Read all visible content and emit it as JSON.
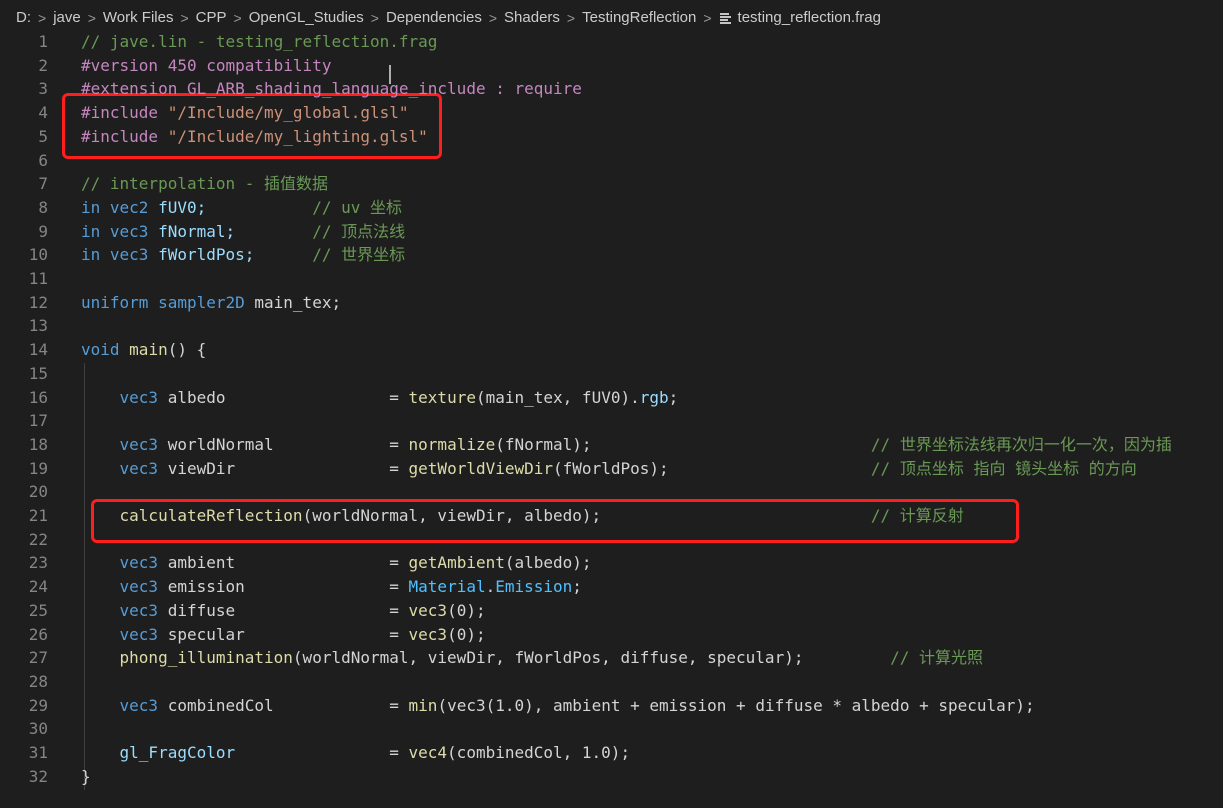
{
  "breadcrumb": {
    "items": [
      "D:",
      "jave",
      "Work Files",
      "CPP",
      "OpenGL_Studies",
      "Dependencies",
      "Shaders",
      "TestingReflection"
    ],
    "file": "testing_reflection.frag",
    "separator": ">"
  },
  "editor": {
    "lines": [
      {
        "n": "1",
        "tokens": [
          [
            "// jave.lin - testing_reflection",
            "comment"
          ],
          [
            ".frag",
            "comment"
          ]
        ]
      },
      {
        "n": "2",
        "tokens": [
          [
            "#version 450 compatibility",
            "pp"
          ]
        ]
      },
      {
        "n": "3",
        "tokens": [
          [
            "#extension GL_ARB_shading_language_include : require",
            "pp"
          ]
        ]
      },
      {
        "n": "4",
        "tokens": [
          [
            "#include ",
            "pp"
          ],
          [
            "\"/Include/my_global.glsl\"",
            "str"
          ]
        ]
      },
      {
        "n": "5",
        "tokens": [
          [
            "#include ",
            "pp"
          ],
          [
            "\"/Include/my_lighting.glsl\"",
            "str"
          ]
        ]
      },
      {
        "n": "6",
        "tokens": []
      },
      {
        "n": "7",
        "tokens": [
          [
            "// interpolation - 插值数据",
            "comment"
          ]
        ]
      },
      {
        "n": "8",
        "tokens": [
          [
            "in ",
            "kw"
          ],
          [
            "vec2 ",
            "kw"
          ],
          [
            "fUV0;           ",
            "var"
          ],
          [
            "// uv 坐标",
            "comment"
          ]
        ]
      },
      {
        "n": "9",
        "tokens": [
          [
            "in ",
            "kw"
          ],
          [
            "vec3 ",
            "kw"
          ],
          [
            "fNormal;        ",
            "var"
          ],
          [
            "// 顶点法线",
            "comment"
          ]
        ]
      },
      {
        "n": "10",
        "tokens": [
          [
            "in ",
            "kw"
          ],
          [
            "vec3 ",
            "kw"
          ],
          [
            "fWorldPos;      ",
            "var"
          ],
          [
            "// 世界坐标",
            "comment"
          ]
        ]
      },
      {
        "n": "11",
        "tokens": []
      },
      {
        "n": "12",
        "tokens": [
          [
            "uniform ",
            "kw"
          ],
          [
            "sampler2D ",
            "kw"
          ],
          [
            "main_tex;",
            "plain"
          ]
        ]
      },
      {
        "n": "13",
        "tokens": []
      },
      {
        "n": "14",
        "tokens": [
          [
            "void ",
            "kw"
          ],
          [
            "main",
            "fn"
          ],
          [
            "() {",
            "plain"
          ]
        ]
      },
      {
        "n": "15",
        "tokens": []
      },
      {
        "n": "16",
        "tokens": [
          [
            "    "
          ],
          [
            "vec3 ",
            "kw"
          ],
          [
            "albedo                 = ",
            "plain"
          ],
          [
            "texture",
            "fn"
          ],
          [
            "(main_tex, fUV0).",
            "plain"
          ],
          [
            "rgb",
            "var"
          ],
          [
            ";",
            "plain"
          ]
        ]
      },
      {
        "n": "17",
        "tokens": []
      },
      {
        "n": "18",
        "tokens": [
          [
            "    "
          ],
          [
            "vec3 ",
            "kw"
          ],
          [
            "worldNormal            = ",
            "plain"
          ],
          [
            "normalize",
            "fn"
          ],
          [
            "(fNormal);                             ",
            "plain"
          ],
          [
            "// 世界坐标法线再次归一化一次，因为插",
            "comment"
          ]
        ]
      },
      {
        "n": "19",
        "tokens": [
          [
            "    "
          ],
          [
            "vec3 ",
            "kw"
          ],
          [
            "viewDir                = ",
            "plain"
          ],
          [
            "getWorldViewDir",
            "fn"
          ],
          [
            "(fWorldPos);                     ",
            "plain"
          ],
          [
            "// 顶点坐标 指向 镜头坐标 的方向",
            "comment"
          ]
        ]
      },
      {
        "n": "20",
        "tokens": []
      },
      {
        "n": "21",
        "tokens": [
          [
            "    "
          ],
          [
            "calculateReflection",
            "fn"
          ],
          [
            "(worldNormal, viewDir, albedo);                            ",
            "plain"
          ],
          [
            "// 计算反射",
            "comment"
          ]
        ]
      },
      {
        "n": "22",
        "tokens": []
      },
      {
        "n": "23",
        "tokens": [
          [
            "    "
          ],
          [
            "vec3 ",
            "kw"
          ],
          [
            "ambient                = ",
            "plain"
          ],
          [
            "getAmbient",
            "fn"
          ],
          [
            "(albedo);",
            "plain"
          ]
        ]
      },
      {
        "n": "24",
        "tokens": [
          [
            "    "
          ],
          [
            "vec3 ",
            "kw"
          ],
          [
            "emission               = ",
            "plain"
          ],
          [
            "Material",
            "field"
          ],
          [
            ".",
            "plain"
          ],
          [
            "Emission",
            "field"
          ],
          [
            ";",
            "plain"
          ]
        ]
      },
      {
        "n": "25",
        "tokens": [
          [
            "    "
          ],
          [
            "vec3 ",
            "kw"
          ],
          [
            "diffuse                = ",
            "plain"
          ],
          [
            "vec3",
            "fn"
          ],
          [
            "(0);",
            "plain"
          ]
        ]
      },
      {
        "n": "26",
        "tokens": [
          [
            "    "
          ],
          [
            "vec3 ",
            "kw"
          ],
          [
            "specular               = ",
            "plain"
          ],
          [
            "vec3",
            "fn"
          ],
          [
            "(0);",
            "plain"
          ]
        ]
      },
      {
        "n": "27",
        "tokens": [
          [
            "    "
          ],
          [
            "phong_illumination",
            "fn"
          ],
          [
            "(worldNormal, viewDir, fWorldPos, diffuse, specular);         ",
            "plain"
          ],
          [
            "// 计算光照",
            "comment"
          ]
        ]
      },
      {
        "n": "28",
        "tokens": []
      },
      {
        "n": "29",
        "tokens": [
          [
            "    "
          ],
          [
            "vec3 ",
            "kw"
          ],
          [
            "combinedCol            = ",
            "plain"
          ],
          [
            "min",
            "fn"
          ],
          [
            "(vec3(1.0), ambient + emission + diffuse * albedo + specular);",
            "plain"
          ]
        ]
      },
      {
        "n": "30",
        "tokens": []
      },
      {
        "n": "31",
        "tokens": [
          [
            "    "
          ],
          [
            "gl_FragColor",
            "var"
          ],
          [
            "                = ",
            "plain"
          ],
          [
            "vec4",
            "fn"
          ],
          [
            "(combinedCol, 1.0);",
            "plain"
          ]
        ]
      },
      {
        "n": "32",
        "tokens": [
          [
            "}",
            "plain"
          ]
        ]
      }
    ]
  }
}
